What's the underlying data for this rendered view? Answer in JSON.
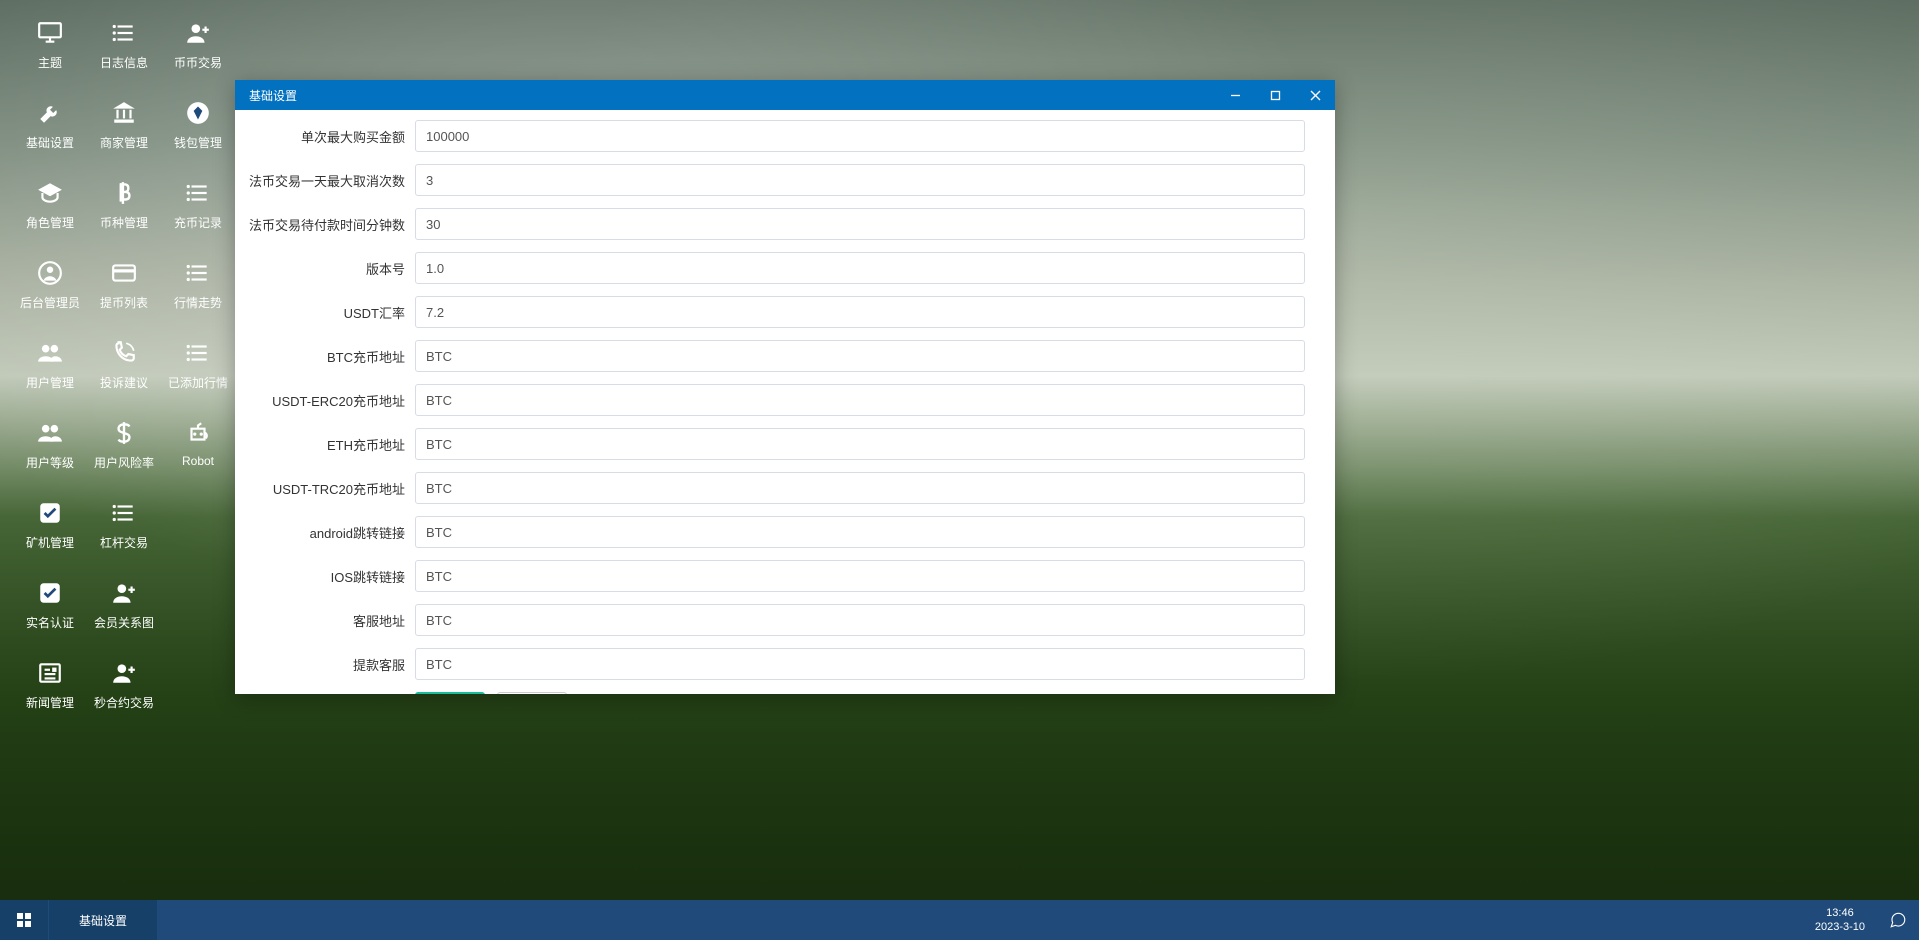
{
  "desktop": {
    "icons": [
      {
        "name": "主题",
        "icon": "monitor"
      },
      {
        "name": "日志信息",
        "icon": "list"
      },
      {
        "name": "币币交易",
        "icon": "user-plus"
      },
      {
        "name": "基础设置",
        "icon": "wrench"
      },
      {
        "name": "商家管理",
        "icon": "bank"
      },
      {
        "name": "钱包管理",
        "icon": "diamond"
      },
      {
        "name": "角色管理",
        "icon": "grad-cap"
      },
      {
        "name": "币种管理",
        "icon": "bitcoin"
      },
      {
        "name": "充币记录",
        "icon": "list"
      },
      {
        "name": "后台管理员",
        "icon": "user-circle"
      },
      {
        "name": "提币列表",
        "icon": "card"
      },
      {
        "name": "行情走势",
        "icon": "list"
      },
      {
        "name": "用户管理",
        "icon": "users"
      },
      {
        "name": "投诉建议",
        "icon": "phone"
      },
      {
        "name": "已添加行情",
        "icon": "list"
      },
      {
        "name": "用户等级",
        "icon": "users"
      },
      {
        "name": "用户风险率",
        "icon": "dollar"
      },
      {
        "name": "Robot",
        "icon": "robot"
      },
      {
        "name": "矿机管理",
        "icon": "check-box"
      },
      {
        "name": "杠杆交易",
        "icon": "list"
      },
      {
        "name": "",
        "icon": ""
      },
      {
        "name": "实名认证",
        "icon": "check-box"
      },
      {
        "name": "会员关系图",
        "icon": "user-plus"
      },
      {
        "name": "",
        "icon": ""
      },
      {
        "name": "新闻管理",
        "icon": "news"
      },
      {
        "name": "秒合约交易",
        "icon": "user-plus"
      },
      {
        "name": "",
        "icon": ""
      }
    ]
  },
  "window": {
    "title": "基础设置",
    "fields": [
      {
        "label": "单次最大购买金额",
        "value": "100000"
      },
      {
        "label": "法币交易一天最大取消次数",
        "value": "3"
      },
      {
        "label": "法币交易待付款时间分钟数",
        "value": "30"
      },
      {
        "label": "版本号",
        "value": "1.0"
      },
      {
        "label": "USDT汇率",
        "value": "7.2"
      },
      {
        "label": "BTC充币地址",
        "value": "BTC"
      },
      {
        "label": "USDT-ERC20充币地址",
        "value": "BTC"
      },
      {
        "label": "ETH充币地址",
        "value": "BTC"
      },
      {
        "label": "USDT-TRC20充币地址",
        "value": "BTC"
      },
      {
        "label": "android跳转链接",
        "value": "BTC"
      },
      {
        "label": "IOS跳转链接",
        "value": "BTC"
      },
      {
        "label": "客服地址",
        "value": "BTC"
      },
      {
        "label": "提款客服",
        "value": "BTC"
      }
    ]
  },
  "taskbar": {
    "active_task": "基础设置",
    "time": "13:46",
    "date": "2023-3-10"
  }
}
